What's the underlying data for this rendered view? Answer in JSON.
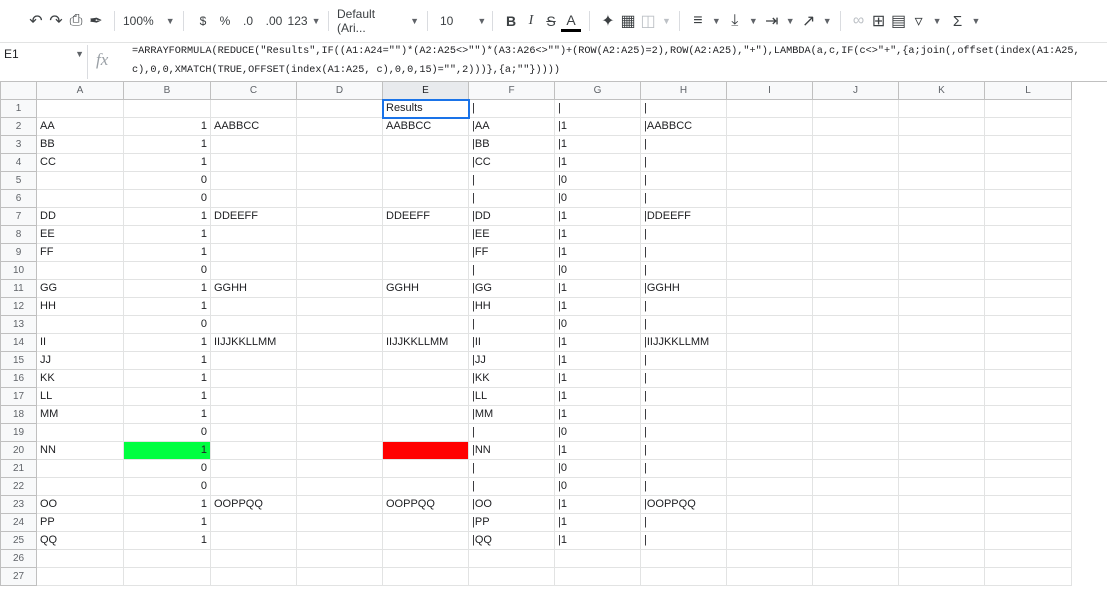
{
  "toolbar": {
    "zoom": "100%",
    "currency": "$",
    "percent": "%",
    "dec_decrease": ".0",
    "dec_increase": ".00",
    "more_formats": "123",
    "font": "Default (Ari...",
    "font_size": "10",
    "bold": "B",
    "italic": "I",
    "strike": "S",
    "text_color": "A",
    "sigma": "Σ"
  },
  "formula_bar": {
    "cell_ref": "E1",
    "formula": "=ARRAYFORMULA(REDUCE(\"Results\",IF((A1:A24=\"\")*(A2:A25<>\"\")*(A3:A26<>\"\")+(ROW(A2:A25)=2),ROW(A2:A25),\"+\"),LAMBDA(a,c,IF(c<>\"+\",{a;join(,offset(index(A1:A25, c),0,0,XMATCH(TRUE,OFFSET(index(A1:A25, c),0,0,15)=\"\",2)))},{a;\"\"}))))"
  },
  "columns": [
    "A",
    "B",
    "C",
    "D",
    "E",
    "F",
    "G",
    "H",
    "I",
    "J",
    "K",
    "L"
  ],
  "rows": [
    {
      "n": "1",
      "A": "",
      "B": "",
      "C": "",
      "D": "",
      "E": "Results",
      "F": "|",
      "G": "|",
      "H": "|"
    },
    {
      "n": "2",
      "A": "AA",
      "B": "1",
      "C": "AABBCC",
      "D": "",
      "E": "AABBCC",
      "F": "|AA",
      "G": "|1",
      "H": "|AABBCC"
    },
    {
      "n": "3",
      "A": "BB",
      "B": "1",
      "C": "",
      "D": "",
      "E": "",
      "F": "|BB",
      "G": "|1",
      "H": "|"
    },
    {
      "n": "4",
      "A": "CC",
      "B": "1",
      "C": "",
      "D": "",
      "E": "",
      "F": "|CC",
      "G": "|1",
      "H": "|"
    },
    {
      "n": "5",
      "A": "",
      "B": "0",
      "C": "",
      "D": "",
      "E": "",
      "F": "|",
      "G": "|0",
      "H": "|"
    },
    {
      "n": "6",
      "A": "",
      "B": "0",
      "C": "",
      "D": "",
      "E": "",
      "F": "|",
      "G": "|0",
      "H": "|"
    },
    {
      "n": "7",
      "A": "DD",
      "B": "1",
      "C": "DDEEFF",
      "D": "",
      "E": "DDEEFF",
      "F": "|DD",
      "G": "|1",
      "H": "|DDEEFF"
    },
    {
      "n": "8",
      "A": "EE",
      "B": "1",
      "C": "",
      "D": "",
      "E": "",
      "F": "|EE",
      "G": "|1",
      "H": "|"
    },
    {
      "n": "9",
      "A": "FF",
      "B": "1",
      "C": "",
      "D": "",
      "E": "",
      "F": "|FF",
      "G": "|1",
      "H": "|"
    },
    {
      "n": "10",
      "A": "",
      "B": "0",
      "C": "",
      "D": "",
      "E": "",
      "F": "|",
      "G": "|0",
      "H": "|"
    },
    {
      "n": "11",
      "A": "GG",
      "B": "1",
      "C": "GGHH",
      "D": "",
      "E": "GGHH",
      "F": "|GG",
      "G": "|1",
      "H": "|GGHH"
    },
    {
      "n": "12",
      "A": "HH",
      "B": "1",
      "C": "",
      "D": "",
      "E": "",
      "F": "|HH",
      "G": "|1",
      "H": "|"
    },
    {
      "n": "13",
      "A": "",
      "B": "0",
      "C": "",
      "D": "",
      "E": "",
      "F": "|",
      "G": "|0",
      "H": "|"
    },
    {
      "n": "14",
      "A": "II",
      "B": "1",
      "C": "IIJJKKLLMM",
      "D": "",
      "E": "IIJJKKLLMM",
      "F": "|II",
      "G": "|1",
      "H": "|IIJJKKLLMM"
    },
    {
      "n": "15",
      "A": "JJ",
      "B": "1",
      "C": "",
      "D": "",
      "E": "",
      "F": "|JJ",
      "G": "|1",
      "H": "|"
    },
    {
      "n": "16",
      "A": "KK",
      "B": "1",
      "C": "",
      "D": "",
      "E": "",
      "F": "|KK",
      "G": "|1",
      "H": "|"
    },
    {
      "n": "17",
      "A": "LL",
      "B": "1",
      "C": "",
      "D": "",
      "E": "",
      "F": "|LL",
      "G": "|1",
      "H": "|"
    },
    {
      "n": "18",
      "A": "MM",
      "B": "1",
      "C": "",
      "D": "",
      "E": "",
      "F": "|MM",
      "G": "|1",
      "H": "|"
    },
    {
      "n": "19",
      "A": "",
      "B": "0",
      "C": "",
      "D": "",
      "E": "",
      "F": "|",
      "G": "|0",
      "H": "|"
    },
    {
      "n": "20",
      "A": "NN",
      "B": "1",
      "C": "",
      "D": "",
      "E": "",
      "F": "|NN",
      "G": "|1",
      "H": "|"
    },
    {
      "n": "21",
      "A": "",
      "B": "0",
      "C": "",
      "D": "",
      "E": "",
      "F": "|",
      "G": "|0",
      "H": "|"
    },
    {
      "n": "22",
      "A": "",
      "B": "0",
      "C": "",
      "D": "",
      "E": "",
      "F": "|",
      "G": "|0",
      "H": "|"
    },
    {
      "n": "23",
      "A": "OO",
      "B": "1",
      "C": "OOPPQQ",
      "D": "",
      "E": "OOPPQQ",
      "F": "|OO",
      "G": "|1",
      "H": "|OOPPQQ"
    },
    {
      "n": "24",
      "A": "PP",
      "B": "1",
      "C": "",
      "D": "",
      "E": "",
      "F": "|PP",
      "G": "|1",
      "H": "|"
    },
    {
      "n": "25",
      "A": "QQ",
      "B": "1",
      "C": "",
      "D": "",
      "E": "",
      "F": "|QQ",
      "G": "|1",
      "H": "|"
    },
    {
      "n": "26",
      "A": "",
      "B": "",
      "C": "",
      "D": "",
      "E": "",
      "F": "",
      "G": "",
      "H": ""
    },
    {
      "n": "27",
      "A": "",
      "B": "",
      "C": "",
      "D": "",
      "E": "",
      "F": "",
      "G": "",
      "H": ""
    }
  ],
  "highlights": {
    "green_cell": "B20",
    "red_cell": "E20",
    "green": "#00ff40",
    "red": "#ff0000",
    "selected_cell": "E1",
    "selection_color": "#1a73e8"
  }
}
